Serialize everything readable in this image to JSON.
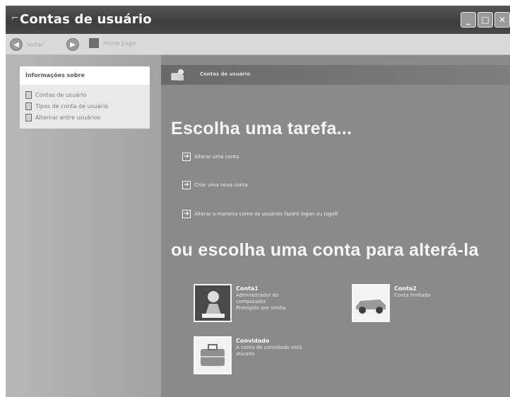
{
  "window": {
    "title": "Contas de usuário",
    "minimize_glyph": "_",
    "maximize_glyph": "□",
    "close_glyph": "✕"
  },
  "toolbar": {
    "back_label": "Voltar",
    "home_label": "Home page"
  },
  "sidebar": {
    "panel_title": "Informações sobre",
    "items": [
      {
        "label": "Contas de usuário",
        "icon": "help-icon"
      },
      {
        "label": "Tipos de conta de usuário",
        "icon": "help-icon"
      },
      {
        "label": "Alternar entre usuários",
        "icon": "help-icon"
      }
    ]
  },
  "content": {
    "header_title": "Contas de usuário",
    "heading_tasks": "Escolha uma tarefa...",
    "tasks": [
      {
        "label": "Alterar uma conta"
      },
      {
        "label": "Criar uma nova conta"
      },
      {
        "label": "Alterar a maneira como os usuários fazem logon ou logoff"
      }
    ],
    "heading_accounts": "ou escolha uma conta para alterá-la",
    "accounts": [
      {
        "name": "Conta1",
        "lines": [
          "Administrador do",
          "computador",
          "Protegido por senha"
        ],
        "picture": "chess-icon"
      },
      {
        "name": "Conta2",
        "lines": [
          "Conta limitada"
        ],
        "picture": "car-icon"
      },
      {
        "name": "Convidado",
        "lines": [
          "A conta de convidado está",
          "ativada"
        ],
        "picture": "suitcase-icon"
      }
    ]
  }
}
